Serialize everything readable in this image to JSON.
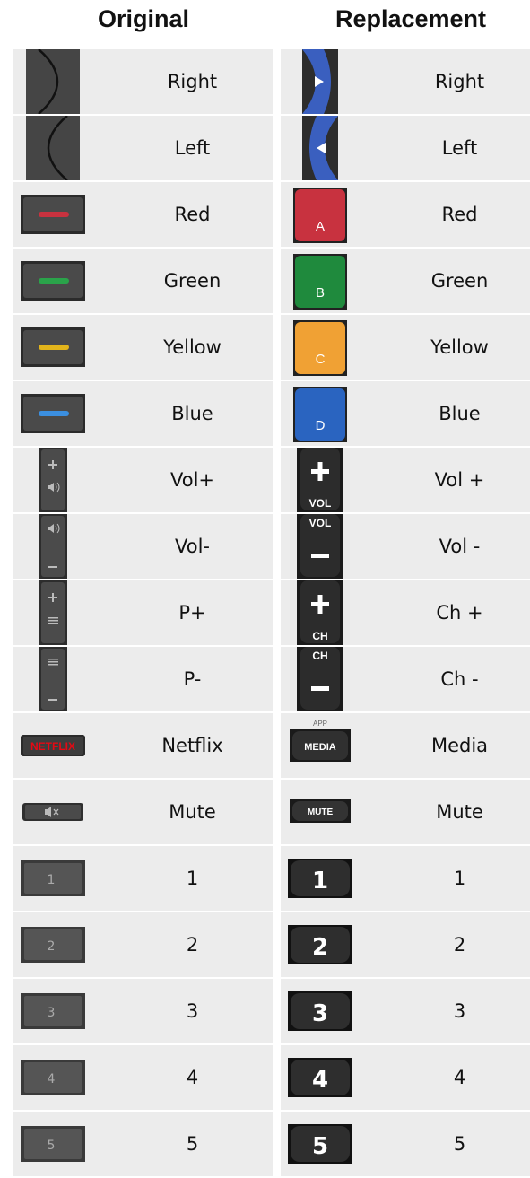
{
  "headers": {
    "original": "Original",
    "replacement": "Replacement"
  },
  "rows": [
    {
      "original_label": "Right",
      "original_icon": "right-arrow-key-icon",
      "replacement_label": "Right",
      "replacement_icon": "blue-right-arrow-icon"
    },
    {
      "original_label": "Left",
      "original_icon": "left-arrow-key-icon",
      "replacement_label": "Left",
      "replacement_icon": "blue-left-arrow-icon"
    },
    {
      "original_label": "Red",
      "original_icon": "red-bar-button-icon",
      "replacement_label": "Red",
      "replacement_icon": "red-a-button-icon",
      "replacement_glyph": "A"
    },
    {
      "original_label": "Green",
      "original_icon": "green-bar-button-icon",
      "replacement_label": "Green",
      "replacement_icon": "green-b-button-icon",
      "replacement_glyph": "B"
    },
    {
      "original_label": "Yellow",
      "original_icon": "yellow-bar-button-icon",
      "replacement_label": "Yellow",
      "replacement_icon": "yellow-c-button-icon",
      "replacement_glyph": "C"
    },
    {
      "original_label": "Blue",
      "original_icon": "blue-bar-button-icon",
      "replacement_label": "Blue",
      "replacement_icon": "blue-d-button-icon",
      "replacement_glyph": "D"
    },
    {
      "original_label": "Vol+",
      "original_icon": "volume-up-icon",
      "replacement_label": "Vol +",
      "replacement_icon": "vol-plus-button-icon",
      "replacement_text": "VOL"
    },
    {
      "original_label": "Vol-",
      "original_icon": "volume-down-icon",
      "replacement_label": "Vol -",
      "replacement_icon": "vol-minus-button-icon",
      "replacement_text": "VOL"
    },
    {
      "original_label": "P+",
      "original_icon": "program-up-icon",
      "replacement_label": "Ch +",
      "replacement_icon": "ch-plus-button-icon",
      "replacement_text": "CH"
    },
    {
      "original_label": "P-",
      "original_icon": "program-down-icon",
      "replacement_label": "Ch -",
      "replacement_icon": "ch-minus-button-icon",
      "replacement_text": "CH"
    },
    {
      "original_label": "Netflix",
      "original_icon": "netflix-button-icon",
      "original_text": "NETFLIX",
      "replacement_label": "Media",
      "replacement_icon": "media-button-icon",
      "replacement_text": "MEDIA",
      "replacement_subtext": "APP"
    },
    {
      "original_label": "Mute",
      "original_icon": "mute-button-icon",
      "replacement_label": "Mute",
      "replacement_icon": "mute-text-button-icon",
      "replacement_text": "MUTE"
    },
    {
      "original_label": "1",
      "original_icon": "digit-1-button-icon",
      "original_glyph": "1",
      "replacement_label": "1",
      "replacement_icon": "digit-1-black-button-icon",
      "replacement_glyph": "1"
    },
    {
      "original_label": "2",
      "original_icon": "digit-2-button-icon",
      "original_glyph": "2",
      "replacement_label": "2",
      "replacement_icon": "digit-2-black-button-icon",
      "replacement_glyph": "2"
    },
    {
      "original_label": "3",
      "original_icon": "digit-3-button-icon",
      "original_glyph": "3",
      "replacement_label": "3",
      "replacement_icon": "digit-3-black-button-icon",
      "replacement_glyph": "3"
    },
    {
      "original_label": "4",
      "original_icon": "digit-4-button-icon",
      "original_glyph": "4",
      "replacement_label": "4",
      "replacement_icon": "digit-4-black-button-icon",
      "replacement_glyph": "4"
    },
    {
      "original_label": "5",
      "original_icon": "digit-5-button-icon",
      "original_glyph": "5",
      "replacement_label": "5",
      "replacement_icon": "digit-5-black-button-icon",
      "replacement_glyph": "5"
    }
  ],
  "colors": {
    "row_bg": "#ececec",
    "button_dark": "#3c3c3c",
    "red": "#c8323f",
    "green": "#1f8a3d",
    "yellow": "#f0a134",
    "blue": "#2a64c0",
    "arrow_blue": "#3a5fbf"
  }
}
